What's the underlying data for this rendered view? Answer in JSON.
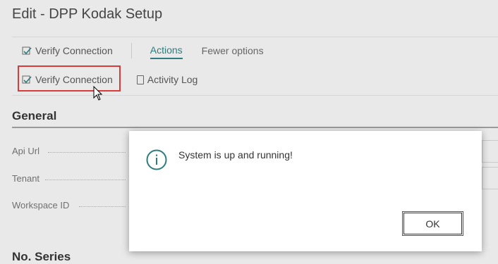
{
  "page": {
    "title": "Edit - DPP Kodak Setup"
  },
  "action_bar": {
    "row1": {
      "verify_connection": "Verify Connection",
      "actions_tab": "Actions",
      "fewer_options": "Fewer options"
    },
    "row2": {
      "verify_connection": "Verify Connection",
      "activity_log": "Activity Log"
    }
  },
  "sections": {
    "general": {
      "title": "General",
      "fields": [
        {
          "label": "Api Url"
        },
        {
          "label": "Tenant"
        },
        {
          "label": "Workspace ID"
        }
      ]
    },
    "no_series": {
      "title": "No. Series"
    }
  },
  "dialog": {
    "message": "System is up and running!",
    "ok_label": "OK",
    "icon": "info-icon"
  },
  "colors": {
    "accent": "#2e7c7c",
    "highlight": "#d93b3b",
    "background": "#e9e9e9"
  }
}
